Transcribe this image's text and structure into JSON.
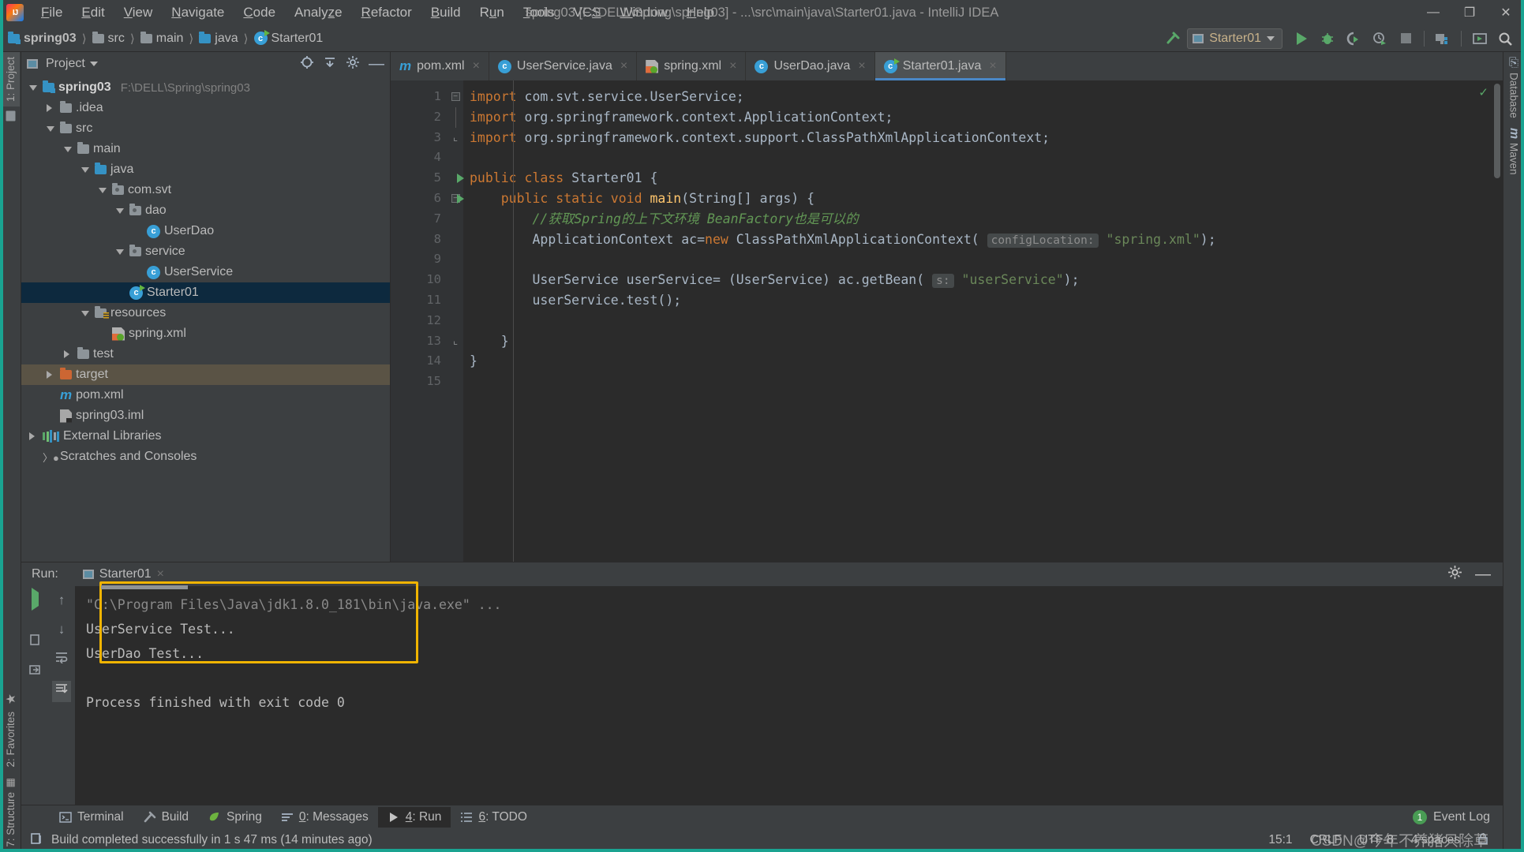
{
  "window": {
    "title": "spring03 [F:\\DELL\\Spring\\spring03] - ...\\src\\main\\java\\Starter01.java - IntelliJ IDEA",
    "minimize": "—",
    "maximize": "❐",
    "close": "✕"
  },
  "menubar": [
    {
      "label": "File",
      "mnemonic": "F"
    },
    {
      "label": "Edit",
      "mnemonic": "E"
    },
    {
      "label": "View",
      "mnemonic": "V"
    },
    {
      "label": "Navigate",
      "mnemonic": "N"
    },
    {
      "label": "Code",
      "mnemonic": "C"
    },
    {
      "label": "Analyze",
      "mnemonic": "z"
    },
    {
      "label": "Refactor",
      "mnemonic": "R"
    },
    {
      "label": "Build",
      "mnemonic": "B"
    },
    {
      "label": "Run",
      "mnemonic": "u"
    },
    {
      "label": "Tools",
      "mnemonic": "T"
    },
    {
      "label": "VCS",
      "mnemonic": "S"
    },
    {
      "label": "Window",
      "mnemonic": "W"
    },
    {
      "label": "Help",
      "mnemonic": "H"
    }
  ],
  "breadcrumb": [
    {
      "label": "spring03",
      "icon": "module-folder-icon",
      "bold": true
    },
    {
      "label": "src",
      "icon": "folder-icon",
      "bold": false
    },
    {
      "label": "main",
      "icon": "folder-icon",
      "bold": false
    },
    {
      "label": "java",
      "icon": "source-folder-icon",
      "bold": false
    },
    {
      "label": "Starter01",
      "icon": "java-class-icon",
      "bold": false
    }
  ],
  "toolbar": {
    "run_config": "Starter01",
    "buttons": [
      "build-hammer-icon",
      "run-icon",
      "debug-icon",
      "run-coverage-icon",
      "profile-icon",
      "stop-icon",
      "project-structure-icon",
      "update-icon",
      "search-everywhere-icon"
    ]
  },
  "left_stripe": [
    {
      "label": "1: Project",
      "active": true
    },
    {
      "label": "2: Favorites",
      "active": false
    },
    {
      "label": "7: Structure",
      "active": false
    }
  ],
  "right_stripe": [
    {
      "label": "Database"
    },
    {
      "label": "Maven"
    }
  ],
  "project_panel": {
    "title": "Project",
    "tools": [
      "locate-icon",
      "collapse-all-icon",
      "settings-gear-icon",
      "hide-icon"
    ],
    "tree": [
      {
        "label": "spring03",
        "path": "F:\\DELL\\Spring\\spring03",
        "indent": 0,
        "arrow": "open",
        "icon": "module-folder-icon",
        "bold": true,
        "state": "normal"
      },
      {
        "label": ".idea",
        "path": "",
        "indent": 1,
        "arrow": "closed",
        "icon": "folder-icon",
        "bold": false,
        "state": "normal"
      },
      {
        "label": "src",
        "path": "",
        "indent": 1,
        "arrow": "open",
        "icon": "folder-icon",
        "bold": false,
        "state": "normal"
      },
      {
        "label": "main",
        "path": "",
        "indent": 2,
        "arrow": "open",
        "icon": "folder-icon",
        "bold": false,
        "state": "normal"
      },
      {
        "label": "java",
        "path": "",
        "indent": 3,
        "arrow": "open",
        "icon": "source-folder-icon",
        "bold": false,
        "state": "normal"
      },
      {
        "label": "com.svt",
        "path": "",
        "indent": 4,
        "arrow": "open",
        "icon": "package-icon",
        "bold": false,
        "state": "normal"
      },
      {
        "label": "dao",
        "path": "",
        "indent": 5,
        "arrow": "open",
        "icon": "package-icon",
        "bold": false,
        "state": "normal"
      },
      {
        "label": "UserDao",
        "path": "",
        "indent": 6,
        "arrow": "none",
        "icon": "java-class-icon",
        "bold": false,
        "state": "normal"
      },
      {
        "label": "service",
        "path": "",
        "indent": 5,
        "arrow": "open",
        "icon": "package-icon",
        "bold": false,
        "state": "normal"
      },
      {
        "label": "UserService",
        "path": "",
        "indent": 6,
        "arrow": "none",
        "icon": "java-class-icon",
        "bold": false,
        "state": "normal"
      },
      {
        "label": "Starter01",
        "path": "",
        "indent": 5,
        "arrow": "none",
        "icon": "java-runnable-class-icon",
        "bold": false,
        "state": "selected"
      },
      {
        "label": "resources",
        "path": "",
        "indent": 3,
        "arrow": "open",
        "icon": "resources-folder-icon",
        "bold": false,
        "state": "normal"
      },
      {
        "label": "spring.xml",
        "path": "",
        "indent": 4,
        "arrow": "none",
        "icon": "spring-xml-icon",
        "bold": false,
        "state": "normal"
      },
      {
        "label": "test",
        "path": "",
        "indent": 2,
        "arrow": "closed",
        "icon": "folder-icon",
        "bold": false,
        "state": "normal"
      },
      {
        "label": "target",
        "path": "",
        "indent": 1,
        "arrow": "closed",
        "icon": "excluded-folder-icon",
        "bold": false,
        "state": "highlight"
      },
      {
        "label": "pom.xml",
        "path": "",
        "indent": 1,
        "arrow": "none",
        "icon": "maven-icon",
        "bold": false,
        "state": "normal"
      },
      {
        "label": "spring03.iml",
        "path": "",
        "indent": 1,
        "arrow": "none",
        "icon": "iml-icon",
        "bold": false,
        "state": "normal"
      },
      {
        "label": "External Libraries",
        "path": "",
        "indent": 0,
        "arrow": "closed",
        "icon": "libraries-icon",
        "bold": false,
        "state": "normal"
      },
      {
        "label": "Scratches and Consoles",
        "path": "",
        "indent": 0,
        "arrow": "none",
        "icon": "scratches-icon",
        "bold": false,
        "state": "normal"
      }
    ]
  },
  "editor": {
    "tabs": [
      {
        "label": "pom.xml",
        "icon": "maven-icon",
        "active": false
      },
      {
        "label": "UserService.java",
        "icon": "java-class-icon",
        "active": false
      },
      {
        "label": "spring.xml",
        "icon": "spring-xml-icon",
        "active": false
      },
      {
        "label": "UserDao.java",
        "icon": "java-class-icon",
        "active": false
      },
      {
        "label": "Starter01.java",
        "icon": "java-runnable-class-icon",
        "active": true
      }
    ],
    "close_glyph": "×",
    "line_numbers": [
      "1",
      "2",
      "3",
      "4",
      "5",
      "6",
      "7",
      "8",
      "9",
      "10",
      "11",
      "12",
      "13",
      "14",
      "15"
    ],
    "lines": [
      {
        "n": 1,
        "segments": [
          {
            "t": "import ",
            "c": "kw"
          },
          {
            "t": "com.svt.service.UserService;",
            "c": ""
          }
        ],
        "indent": 0,
        "runmark": false,
        "fold": "minus"
      },
      {
        "n": 2,
        "segments": [
          {
            "t": "import ",
            "c": "kw"
          },
          {
            "t": "org.springframework.context.ApplicationContext;",
            "c": ""
          }
        ],
        "indent": 0,
        "runmark": false,
        "fold": "line"
      },
      {
        "n": 3,
        "segments": [
          {
            "t": "import ",
            "c": "kw"
          },
          {
            "t": "org.springframework.context.support.ClassPathXmlApplicationContext;",
            "c": ""
          }
        ],
        "indent": 0,
        "runmark": false,
        "fold": "end"
      },
      {
        "n": 4,
        "segments": [],
        "indent": 0,
        "runmark": false,
        "fold": ""
      },
      {
        "n": 5,
        "segments": [
          {
            "t": "public class ",
            "c": "kw"
          },
          {
            "t": "Starter01 {",
            "c": ""
          }
        ],
        "indent": 0,
        "runmark": true,
        "fold": ""
      },
      {
        "n": 6,
        "segments": [
          {
            "t": "    public static void ",
            "c": "kw"
          },
          {
            "t": "main",
            "c": "mtd"
          },
          {
            "t": "(String[] args) {",
            "c": ""
          }
        ],
        "indent": 0,
        "runmark": true,
        "fold": "minus"
      },
      {
        "n": 7,
        "segments": [
          {
            "t": "        //获取Spring的上下文环境 BeanFactory也是可以的",
            "c": "cmt"
          }
        ],
        "indent": 0,
        "runmark": false,
        "fold": ""
      },
      {
        "n": 8,
        "segments": [
          {
            "t": "        ApplicationContext ac=",
            "c": ""
          },
          {
            "t": "new ",
            "c": "kw"
          },
          {
            "t": "ClassPathXmlApplicationContext( ",
            "c": ""
          },
          {
            "t": "configLocation:",
            "c": "hint"
          },
          {
            "t": " ",
            "c": ""
          },
          {
            "t": "\"spring.xml\"",
            "c": "str"
          },
          {
            "t": ");",
            "c": ""
          }
        ],
        "indent": 0,
        "runmark": false,
        "fold": ""
      },
      {
        "n": 9,
        "segments": [],
        "indent": 0,
        "runmark": false,
        "fold": ""
      },
      {
        "n": 10,
        "segments": [
          {
            "t": "        UserService userService= (UserService) ac.getBean( ",
            "c": ""
          },
          {
            "t": "s:",
            "c": "hint"
          },
          {
            "t": " ",
            "c": ""
          },
          {
            "t": "\"userService\"",
            "c": "str"
          },
          {
            "t": ");",
            "c": ""
          }
        ],
        "indent": 0,
        "runmark": false,
        "fold": ""
      },
      {
        "n": 11,
        "segments": [
          {
            "t": "        userService.test();",
            "c": ""
          }
        ],
        "indent": 0,
        "runmark": false,
        "fold": ""
      },
      {
        "n": 12,
        "segments": [],
        "indent": 0,
        "runmark": false,
        "fold": ""
      },
      {
        "n": 13,
        "segments": [
          {
            "t": "    }",
            "c": ""
          }
        ],
        "indent": 0,
        "runmark": false,
        "fold": "end"
      },
      {
        "n": 14,
        "segments": [
          {
            "t": "}",
            "c": ""
          }
        ],
        "indent": 0,
        "runmark": false,
        "fold": ""
      },
      {
        "n": 15,
        "segments": [],
        "indent": 0,
        "runmark": false,
        "fold": ""
      }
    ]
  },
  "run_panel": {
    "label": "Run:",
    "tab_label": "Starter01",
    "close_glyph": "×",
    "tools": [
      "settings-gear-icon",
      "hide-panel-icon"
    ],
    "left_tools": [
      "rerun-icon",
      "stop-icon",
      "dump-threads-icon",
      "restore-layout-icon"
    ],
    "left_tools2": [
      "up-arrow-icon",
      "down-arrow-icon",
      "soft-wrap-icon",
      "scroll-to-end-icon"
    ],
    "console_lines": [
      {
        "text": "\"C:\\Program Files\\Java\\jdk1.8.0_181\\bin\\java.exe\" ...",
        "dim": true
      },
      {
        "text": "UserService Test...",
        "dim": false
      },
      {
        "text": "UserDao Test...",
        "dim": false
      },
      {
        "text": "",
        "dim": false
      },
      {
        "text": "Process finished with exit code 0",
        "dim": false
      }
    ]
  },
  "bottom_stripe": [
    {
      "label": "Terminal",
      "mnemonic": "",
      "icon": "terminal-icon",
      "active": false
    },
    {
      "label": "Build",
      "mnemonic": "",
      "icon": "build-hammer-icon",
      "active": false
    },
    {
      "label": "Spring",
      "mnemonic": "",
      "icon": "spring-leaf-icon",
      "active": false
    },
    {
      "label": "0: Messages",
      "mnemonic": "0",
      "icon": "messages-icon",
      "active": false
    },
    {
      "label": "4: Run",
      "mnemonic": "4",
      "icon": "run-icon",
      "active": true
    },
    {
      "label": "6: TODO",
      "mnemonic": "6",
      "icon": "todo-icon",
      "active": false
    }
  ],
  "event_log": {
    "count": "1",
    "label": "Event Log"
  },
  "statusbar": {
    "message": "Build completed successfully in 1 s 47 ms (14 minutes ago)",
    "caret": "15:1",
    "line_sep": "CRLF",
    "encoding": "UTF-8",
    "indent": "4 spaces",
    "watermark": "CSDN@今年不养猪只除草"
  }
}
